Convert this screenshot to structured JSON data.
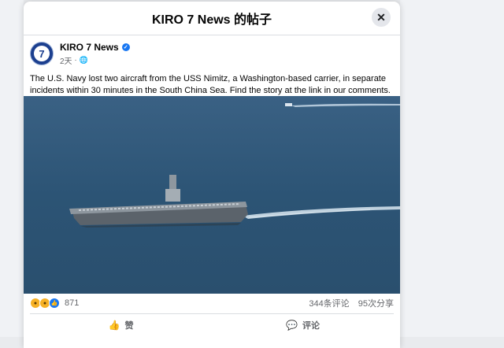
{
  "modal": {
    "title": "KIRO 7 News 的帖子",
    "close_icon": "close-icon"
  },
  "post": {
    "author": "KIRO 7 News",
    "avatar_text": "7",
    "time": "2天",
    "audience_icon": "globe-icon",
    "text": "The U.S. Navy lost two aircraft from the USS Nimitz, a Washington-based carrier, in separate incidents within 30 minutes in the South China Sea. Find the story at the link in our comments.",
    "image_alt": "Aircraft carrier on the ocean"
  },
  "stats": {
    "reaction_count": "871",
    "comments": "344条评论",
    "shares": "95次分享",
    "reaction_icons": [
      "sad-icon",
      "wow-icon",
      "like-icon"
    ]
  },
  "actions": {
    "like_label": "赞",
    "comment_label": "评论"
  },
  "colors": {
    "brand_blue": "#1877f2",
    "text_gray": "#65676b",
    "sea": "#2f5577"
  }
}
